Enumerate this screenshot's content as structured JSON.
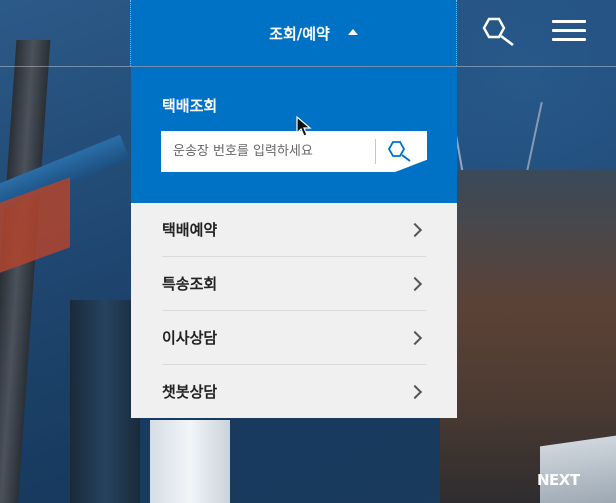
{
  "header": {
    "lookup_tab_label": "조회/예약",
    "search_icon": "search-icon",
    "menu_icon": "hamburger-menu-icon"
  },
  "dropdown": {
    "tracking_title": "택배조회",
    "tracking_placeholder": "운송장 번호를 입력하세요",
    "items": [
      {
        "label": "택배예약"
      },
      {
        "label": "특송조회"
      },
      {
        "label": "이사상담"
      },
      {
        "label": "챗봇상담"
      }
    ]
  },
  "footer": {
    "next_label": "NEXT"
  },
  "colors": {
    "accent": "#0072c6",
    "list_bg": "#f0f0f0"
  }
}
